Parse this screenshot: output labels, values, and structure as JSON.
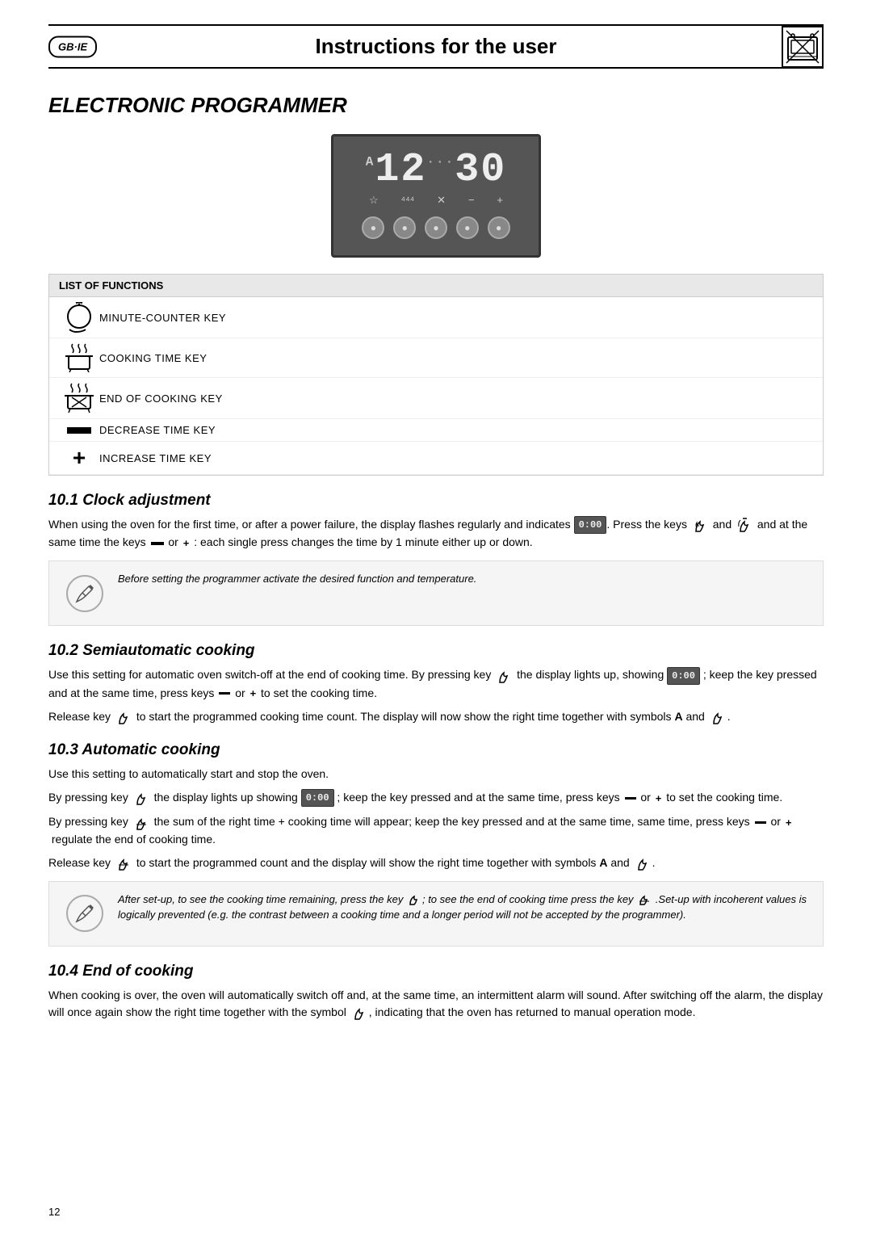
{
  "header": {
    "badge": "GB·IE",
    "title": "Instructions for the user"
  },
  "section": {
    "number": "10.",
    "title": "ELECTRONIC PROGRAMMER"
  },
  "display": {
    "time": "12:30",
    "superscript": "A",
    "button_labels": [
      "☆",
      "⁴",
      "✕",
      "−",
      "+"
    ]
  },
  "functions_table": {
    "header": "LIST OF FUNCTIONS",
    "rows": [
      {
        "label": "MINUTE-COUNTER KEY"
      },
      {
        "label": "COOKING TIME KEY"
      },
      {
        "label": "END OF COOKING KEY"
      },
      {
        "label": "DECREASE TIME KEY"
      },
      {
        "label": "INCREASE TIME KEY"
      }
    ]
  },
  "subsections": {
    "clock": {
      "title": "10.1 Clock adjustment",
      "para1": "When using the oven for the first time, or after a power failure, the display flashes regularly and indicates",
      "para1b": ". Press the keys",
      "para1c": "and",
      "para1d": "and at the same time the keys",
      "para1e": "or",
      "para1f": ": each single press changes the time by 1 minute either up or down.",
      "note_italic": "Before setting the programmer activate the desired function and temperature."
    },
    "semiauto": {
      "title": "10.2 Semiautomatic cooking",
      "para1": "Use this setting for automatic oven switch-off at the end of cooking time. By pressing key",
      "para1b": "the display lights up, showing",
      "para1c": "; keep the key pressed and at the same time, press keys",
      "para1d": "or",
      "para1e": "to set the cooking time.",
      "para2_a": "Release key",
      "para2_b": "to start the programmed cooking time count. The display will now show the right time together with symbols",
      "para2_c": "A",
      "para2_d": "and"
    },
    "auto": {
      "title": "10.3 Automatic cooking",
      "para1": "Use this setting to automatically start and stop the oven.",
      "para2_a": "By pressing key",
      "para2_b": "the display lights up showing",
      "para2_c": "; keep the key pressed and at the same time,",
      "para2_d": "press keys",
      "para2_e": "or",
      "para2_f": "to set the cooking time.",
      "para3_a": "By pressing key",
      "para3_b": "the sum of the right time + cooking time will appear; keep the key pressed and at the same time,",
      "para3_c": "same time, press keys",
      "para3_d": "or",
      "para3_e": "regulate the end of cooking time.",
      "para4_a": "Release key",
      "para4_b": "to start the programmed count and the display will show the right time together with",
      "para4_c": "symbols",
      "para4_d": "A",
      "para4_e": "and",
      "note_italic": "After set-up, to see the cooking time remaining, press the key",
      "note_italic2": "; to see the end of cooking time press the key",
      "note_italic3": ".Set-up with incoherent values is logically prevented (e.g. the contrast between a cooking time and a longer period will not be accepted by the programmer)."
    },
    "endcooking": {
      "title": "10.4 End of cooking",
      "para1": "When cooking is over, the oven will automatically switch off and, at the same time, an intermittent alarm will sound. After switching off the alarm, the display will once again show the right time together with the symbol",
      "para1b": ", indicating that the oven has returned to manual operation mode."
    }
  },
  "page_number": "12"
}
